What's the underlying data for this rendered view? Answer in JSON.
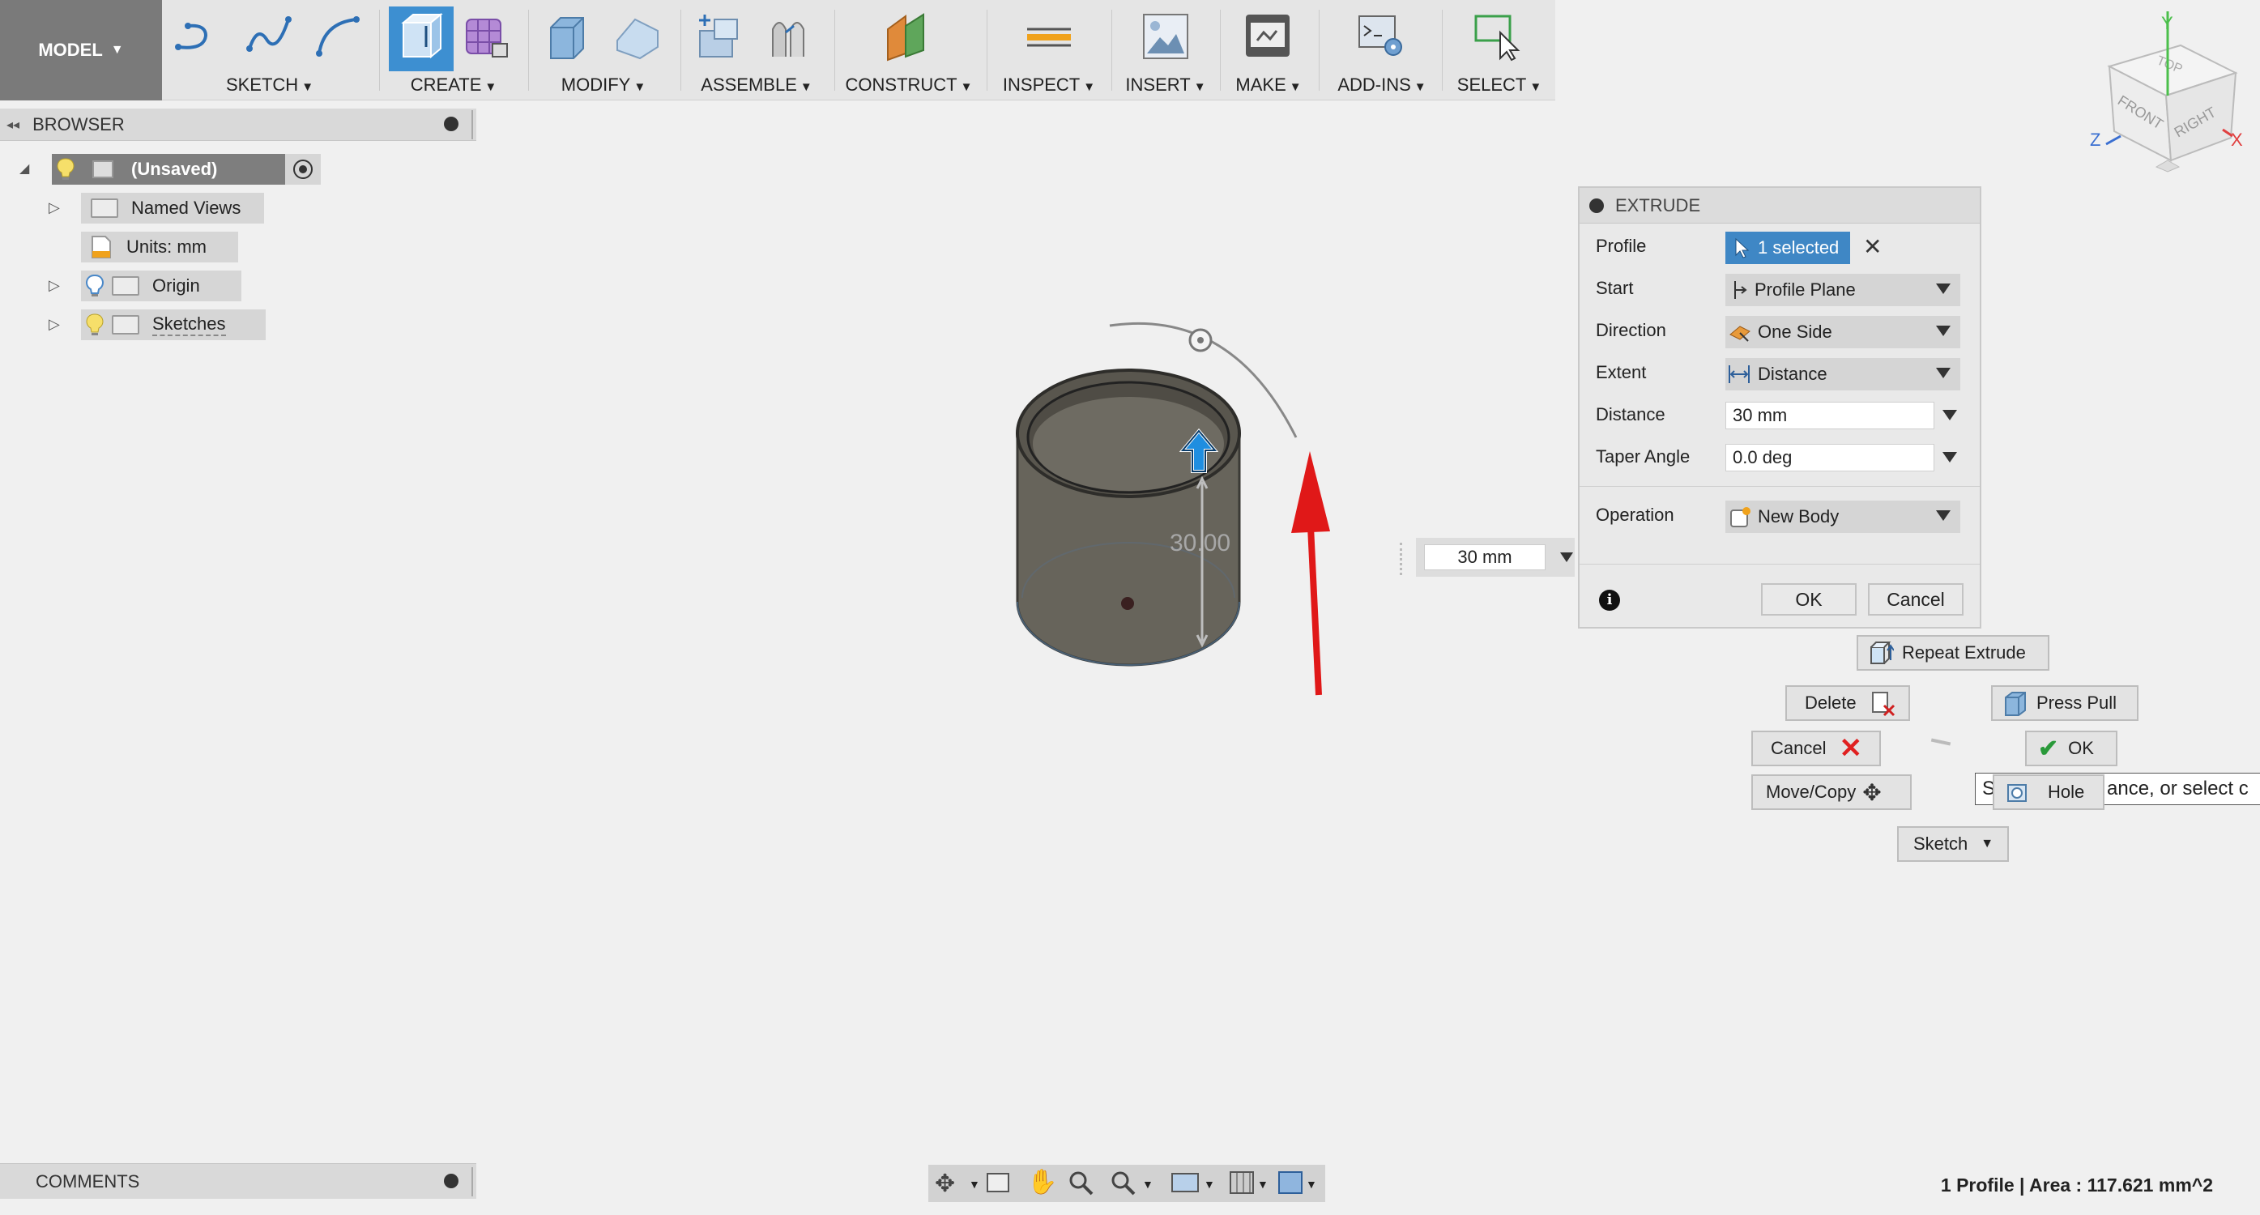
{
  "toolbar": {
    "model_label": "MODEL",
    "groups": [
      {
        "label": "SKETCH"
      },
      {
        "label": "CREATE"
      },
      {
        "label": "MODIFY"
      },
      {
        "label": "ASSEMBLE"
      },
      {
        "label": "CONSTRUCT"
      },
      {
        "label": "INSPECT"
      },
      {
        "label": "INSERT"
      },
      {
        "label": "MAKE"
      },
      {
        "label": "ADD-INS"
      },
      {
        "label": "SELECT"
      }
    ]
  },
  "browser": {
    "title": "BROWSER",
    "items": [
      {
        "label": "(Unsaved)"
      },
      {
        "label": "Named Views"
      },
      {
        "label": "Units: mm"
      },
      {
        "label": "Origin"
      },
      {
        "label": "Sketches"
      }
    ]
  },
  "viewport": {
    "dimension_label": "30.00",
    "distance_input": "30 mm",
    "viewcube": {
      "top": "TOP",
      "front": "FRONT",
      "right": "RIGHT",
      "axis_x": "X",
      "axis_y": "Y",
      "axis_z": "Z"
    }
  },
  "extrude": {
    "title": "EXTRUDE",
    "rows": {
      "profile": {
        "label": "Profile",
        "value": "1 selected"
      },
      "start": {
        "label": "Start",
        "value": "Profile Plane"
      },
      "direction": {
        "label": "Direction",
        "value": "One Side"
      },
      "extent": {
        "label": "Extent",
        "value": "Distance"
      },
      "distance": {
        "label": "Distance",
        "value": "30 mm"
      },
      "taper": {
        "label": "Taper Angle",
        "value": "0.0 deg"
      },
      "operation": {
        "label": "Operation",
        "value": "New Body"
      }
    },
    "ok": "OK",
    "cancel": "Cancel"
  },
  "marking_menu": {
    "repeat": "Repeat Extrude",
    "delete": "Delete",
    "press_pull": "Press Pull",
    "cancel": "Cancel",
    "ok": "OK",
    "move_copy": "Move/Copy",
    "hole": "Hole",
    "sketch": "Sketch",
    "tooltip_prefix": "S",
    "tooltip_text": "ance, or select c"
  },
  "bottom": {
    "comments": "COMMENTS",
    "status": "1 Profile | Area : 117.621 mm^2"
  },
  "colors": {
    "accent": "#3d8fd1",
    "selected": "#3f87c5",
    "arrow_red": "#e01818"
  }
}
